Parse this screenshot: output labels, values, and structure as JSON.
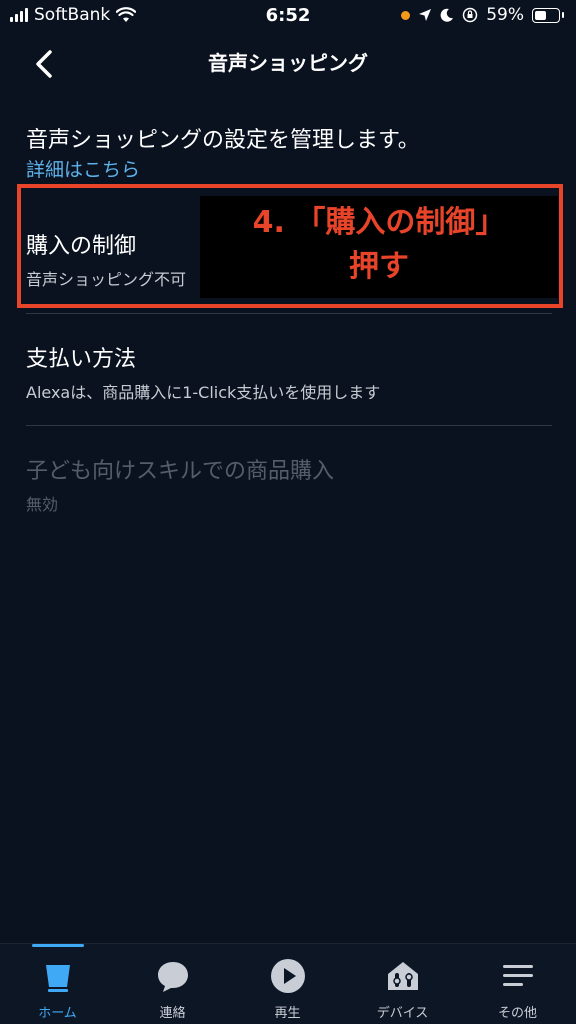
{
  "status_bar": {
    "carrier": "SoftBank",
    "time": "6:52",
    "battery_percent": "59%",
    "battery_level": 0.59
  },
  "nav": {
    "title": "音声ショッピング"
  },
  "intro": {
    "text": "音声ショッピングの設定を管理します。",
    "link": "詳細はこちら"
  },
  "items": [
    {
      "title": "購入の制御",
      "subtitle": "音声ショッピング不可"
    },
    {
      "title": "支払い方法",
      "subtitle": "Alexaは、商品購入に1-Click支払いを使用します"
    },
    {
      "title": "子ども向けスキルでの商品購入",
      "subtitle": "無効"
    }
  ],
  "annotation": {
    "line1": "4. 「購入の制御」",
    "line2": "押す",
    "color": "#e8442a"
  },
  "tabs": [
    {
      "label": "ホーム",
      "icon": "home-icon",
      "active": true
    },
    {
      "label": "連絡",
      "icon": "chat-bubble-icon",
      "active": false
    },
    {
      "label": "再生",
      "icon": "play-icon",
      "active": false
    },
    {
      "label": "デバイス",
      "icon": "devices-icon",
      "active": false
    },
    {
      "label": "その他",
      "icon": "menu-icon",
      "active": false
    }
  ],
  "colors": {
    "background": "#0a1220",
    "accent": "#3fa9f5",
    "link": "#5db1e8"
  }
}
